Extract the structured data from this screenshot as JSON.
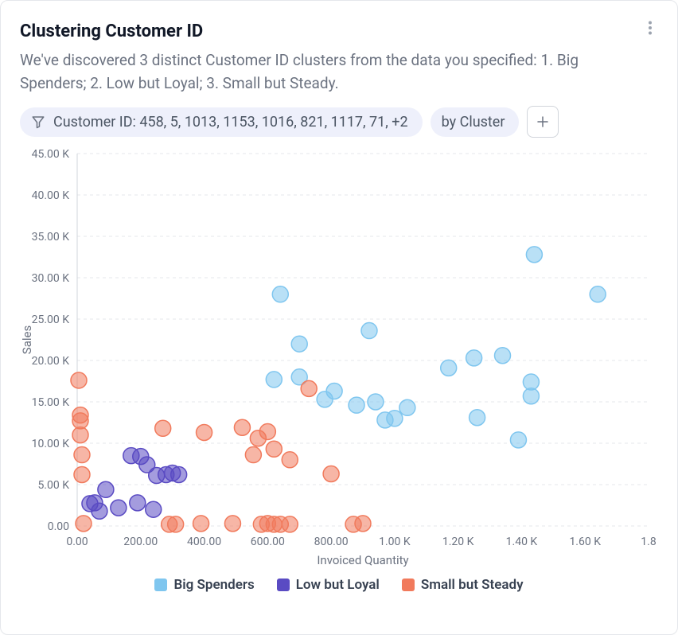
{
  "card": {
    "title": "Clustering Customer ID",
    "description": "We've discovered 3 distinct Customer ID clusters from the data you specified: 1. Big Spenders; 2. Low but Loyal; 3. Small but Steady."
  },
  "chips": {
    "filter_label": "Customer ID: 458, 5, 1013, 1153, 1016, 821, 1117, 71, +2",
    "groupby_label": "by Cluster"
  },
  "legend": {
    "big_spenders": "Big Spenders",
    "low_but_loyal": "Low but Loyal",
    "small_but_steady": "Small but Steady"
  },
  "axes": {
    "xlabel": "Invoiced Quantity",
    "ylabel": "Sales",
    "x_ticks": [
      "0.00",
      "200.00",
      "400.00",
      "600.00",
      "800.00",
      "1.00 K",
      "1.20 K",
      "1.40 K",
      "1.60 K",
      "1.8"
    ],
    "y_ticks": [
      "0.00",
      "5.00 K",
      "10.00 K",
      "15.00 K",
      "20.00 K",
      "25.00 K",
      "30.00 K",
      "35.00 K",
      "40.00 K",
      "45.00 K"
    ]
  },
  "colors": {
    "big_spenders": "#7fc6ef",
    "low_but_loyal": "#5a4bc3",
    "small_but_steady": "#f17a5c"
  },
  "chart_data": {
    "type": "scatter",
    "title": "Clustering Customer ID",
    "xlabel": "Invoiced Quantity",
    "ylabel": "Sales",
    "xlim": [
      0,
      1800
    ],
    "ylim": [
      0,
      45000
    ],
    "legend_position": "bottom",
    "grid": true,
    "series": [
      {
        "name": "Big Spenders",
        "color": "#7fc6ef",
        "points": [
          {
            "x": 640,
            "y": 28000
          },
          {
            "x": 700,
            "y": 22000
          },
          {
            "x": 620,
            "y": 17700
          },
          {
            "x": 700,
            "y": 18000
          },
          {
            "x": 780,
            "y": 15300
          },
          {
            "x": 810,
            "y": 16300
          },
          {
            "x": 880,
            "y": 14600
          },
          {
            "x": 920,
            "y": 23600
          },
          {
            "x": 940,
            "y": 15000
          },
          {
            "x": 970,
            "y": 12800
          },
          {
            "x": 1000,
            "y": 13000
          },
          {
            "x": 1040,
            "y": 14300
          },
          {
            "x": 1170,
            "y": 19100
          },
          {
            "x": 1250,
            "y": 20300
          },
          {
            "x": 1260,
            "y": 13100
          },
          {
            "x": 1340,
            "y": 20600
          },
          {
            "x": 1390,
            "y": 10400
          },
          {
            "x": 1430,
            "y": 17400
          },
          {
            "x": 1440,
            "y": 32800
          },
          {
            "x": 1430,
            "y": 15700
          },
          {
            "x": 1640,
            "y": 28000
          }
        ]
      },
      {
        "name": "Low but Loyal",
        "color": "#5a4bc3",
        "points": [
          {
            "x": 40,
            "y": 2700
          },
          {
            "x": 55,
            "y": 2800
          },
          {
            "x": 70,
            "y": 1800
          },
          {
            "x": 90,
            "y": 4400
          },
          {
            "x": 130,
            "y": 2200
          },
          {
            "x": 170,
            "y": 8500
          },
          {
            "x": 190,
            "y": 2800
          },
          {
            "x": 200,
            "y": 8400
          },
          {
            "x": 220,
            "y": 7400
          },
          {
            "x": 240,
            "y": 2000
          },
          {
            "x": 250,
            "y": 6100
          },
          {
            "x": 280,
            "y": 6200
          },
          {
            "x": 300,
            "y": 6400
          },
          {
            "x": 320,
            "y": 6200
          }
        ]
      },
      {
        "name": "Small but Steady",
        "color": "#f17a5c",
        "points": [
          {
            "x": 5,
            "y": 17600
          },
          {
            "x": 10,
            "y": 13400
          },
          {
            "x": 10,
            "y": 12700
          },
          {
            "x": 10,
            "y": 11000
          },
          {
            "x": 15,
            "y": 8600
          },
          {
            "x": 15,
            "y": 6200
          },
          {
            "x": 20,
            "y": 300
          },
          {
            "x": 270,
            "y": 11800
          },
          {
            "x": 290,
            "y": 200
          },
          {
            "x": 310,
            "y": 200
          },
          {
            "x": 390,
            "y": 300
          },
          {
            "x": 400,
            "y": 11300
          },
          {
            "x": 490,
            "y": 300
          },
          {
            "x": 520,
            "y": 11900
          },
          {
            "x": 555,
            "y": 8600
          },
          {
            "x": 570,
            "y": 10600
          },
          {
            "x": 580,
            "y": 200
          },
          {
            "x": 600,
            "y": 300
          },
          {
            "x": 600,
            "y": 11400
          },
          {
            "x": 620,
            "y": 9300
          },
          {
            "x": 620,
            "y": 200
          },
          {
            "x": 640,
            "y": 200
          },
          {
            "x": 670,
            "y": 200
          },
          {
            "x": 670,
            "y": 8000
          },
          {
            "x": 730,
            "y": 16600
          },
          {
            "x": 800,
            "y": 6300
          },
          {
            "x": 870,
            "y": 200
          },
          {
            "x": 900,
            "y": 300
          }
        ]
      }
    ]
  }
}
